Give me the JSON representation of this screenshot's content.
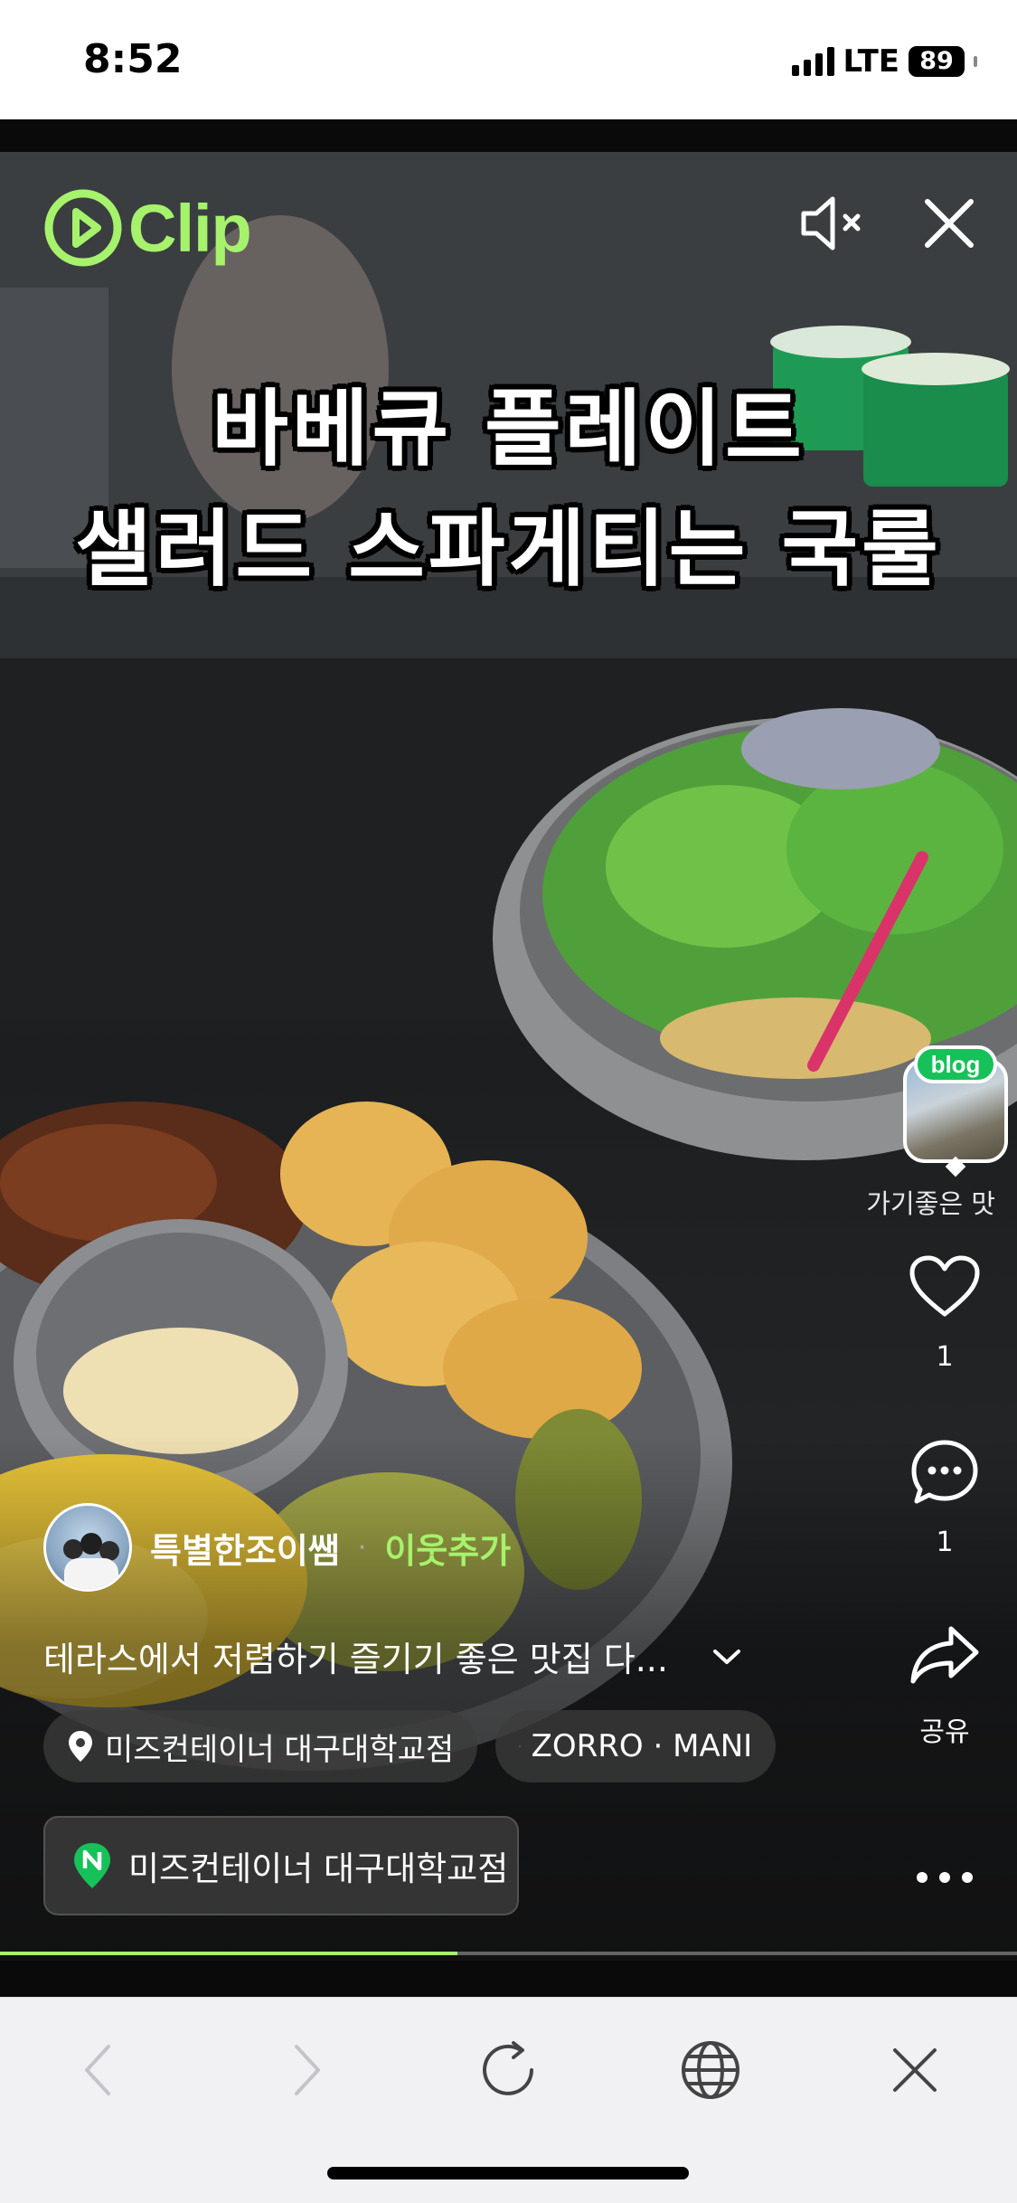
{
  "status_bar": {
    "time": "8:52",
    "network": "LTE",
    "battery": "89"
  },
  "player": {
    "logo_text": "Clip",
    "caption_line1": "바베큐 플레이트",
    "caption_line2": "샐러드 스파게티는 국룰",
    "progress": 0.45
  },
  "side_rail": {
    "blog_badge": "blog",
    "blog_label": "가기좋은 맛",
    "like_count": "1",
    "comment_count": "1",
    "share_label": "공유"
  },
  "info": {
    "author_name": "특별한조이쌤",
    "separator": "·",
    "follow_label": "이웃추가",
    "description": "테라스에서 저렴하기 즐기기 좋은  맛집 다...",
    "location_tag": "미즈컨테이너 대구대학교점",
    "music_tag": "ZORRO · MANI",
    "place_card_label": "미즈컨테이너 대구대학교점"
  },
  "colors": {
    "accent": "#a6f26c",
    "naver_green": "#17c15a"
  },
  "icons": [
    "mute-icon",
    "close-icon",
    "heart-icon",
    "comment-icon",
    "share-icon",
    "more-icon",
    "location-pin-icon",
    "music-note-icon",
    "naver-place-icon",
    "back-icon",
    "forward-icon",
    "reload-icon",
    "globe-icon",
    "close-tab-icon"
  ]
}
